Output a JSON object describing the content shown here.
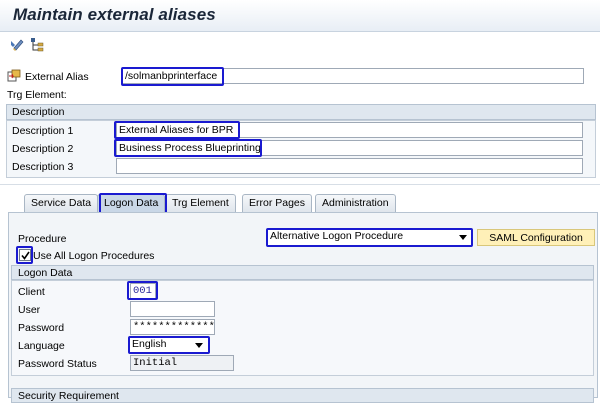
{
  "window": {
    "title": "Maintain external aliases"
  },
  "toolbar": {
    "icons": [
      "edit-pencil-icon",
      "hierarchy-icon"
    ]
  },
  "header": {
    "external_alias_label": "External Alias",
    "external_alias_value": "/solmanbprinterface",
    "target_element_label": "Trg Element:"
  },
  "description": {
    "section_title": "Description",
    "desc1_label": "Description 1",
    "desc1_value": "External Aliases for BPR",
    "desc2_label": "Description 2",
    "desc2_value": "Business Process Blueprinting",
    "desc3_label": "Description 3",
    "desc3_value": ""
  },
  "tabs": [
    {
      "label": "Service Data",
      "active": false
    },
    {
      "label": "Logon Data",
      "active": true
    },
    {
      "label": "Trg Element",
      "active": false
    },
    {
      "label": "Error Pages",
      "active": false
    },
    {
      "label": "Administration",
      "active": false
    }
  ],
  "logon": {
    "procedure_label": "Procedure",
    "procedure_value": "Alternative Logon Procedure",
    "saml_button": "SAML Configuration",
    "use_all_label": "Use All Logon Procedures",
    "use_all_checked": true,
    "logon_data_title": "Logon Data",
    "client_label": "Client",
    "client_value": "001",
    "user_label": "User",
    "user_value": "",
    "password_label": "Password",
    "password_value": "**************",
    "language_label": "Language",
    "language_value": "English",
    "password_status_label": "Password Status",
    "password_status_value": "Initial",
    "security_title": "Security Requirement"
  },
  "colors": {
    "highlight": "#1a1ad0",
    "saml_button": "#fff0b8",
    "section_header": "#dfe7ef"
  }
}
